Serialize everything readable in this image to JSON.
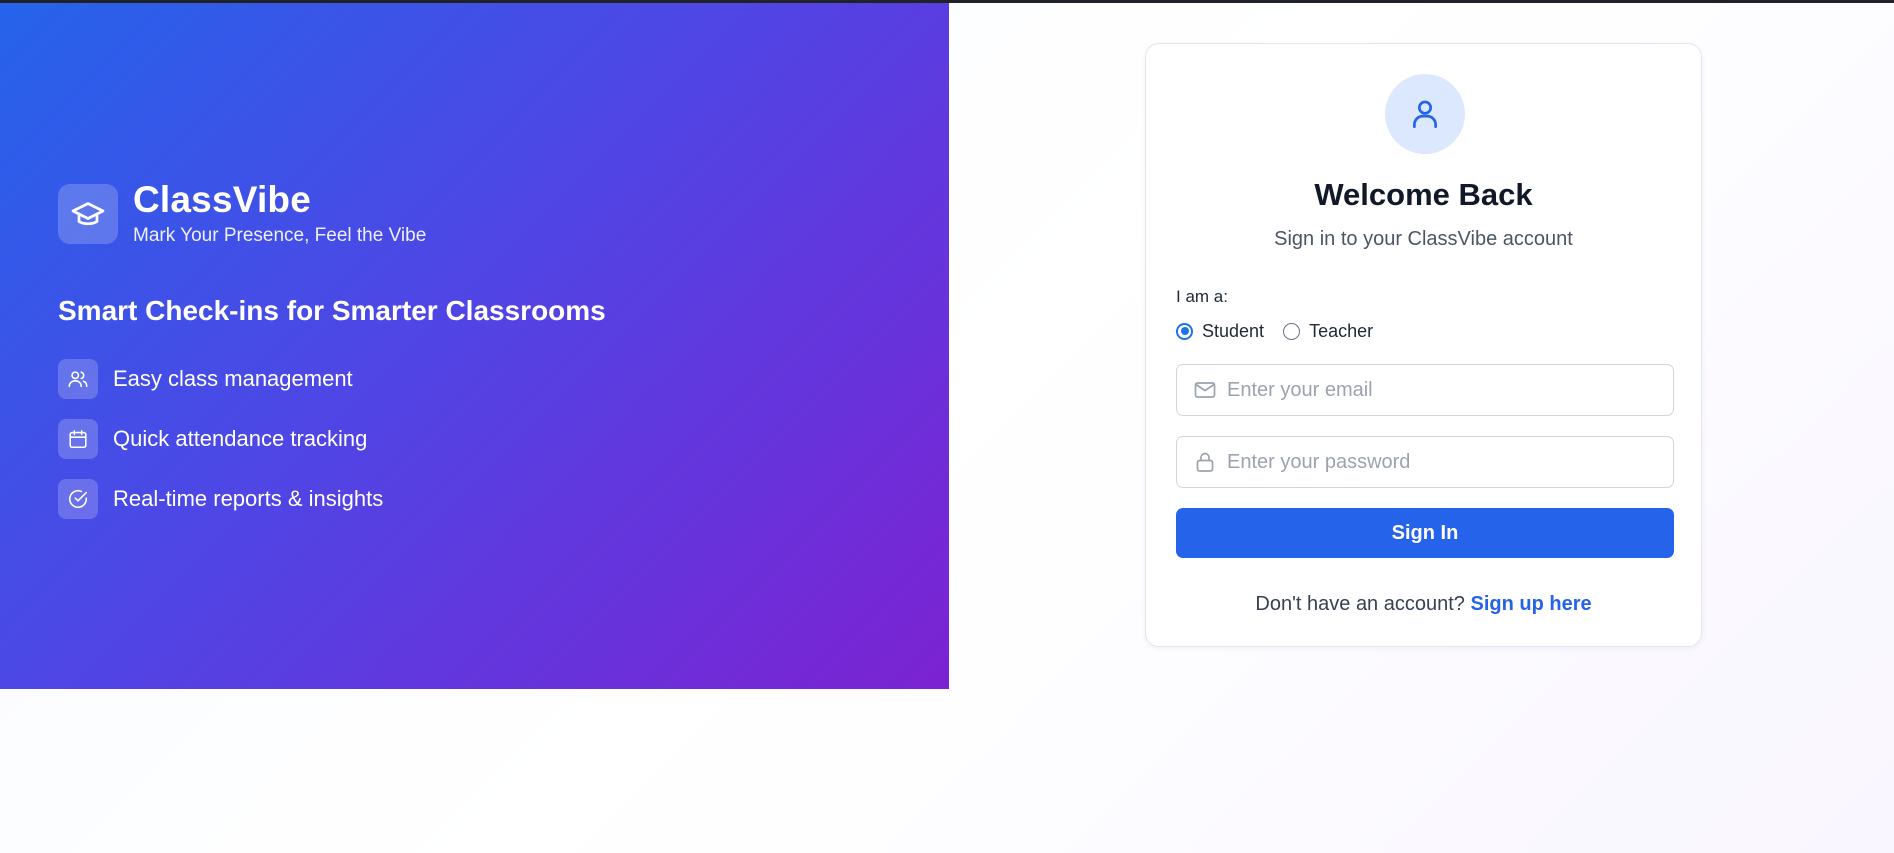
{
  "brand": {
    "name": "ClassVibe",
    "tagline": "Mark Your Presence, Feel the Vibe",
    "logo_icon": "graduation-cap-icon"
  },
  "hero": {
    "headline": "Smart Check-ins for Smarter Classrooms",
    "features": [
      {
        "icon": "users-icon",
        "label": "Easy class management"
      },
      {
        "icon": "calendar-icon",
        "label": "Quick attendance tracking"
      },
      {
        "icon": "check-circle-icon",
        "label": "Real-time reports & insights"
      }
    ],
    "gradient": [
      "#2563eb",
      "#4f46e5",
      "#7c22d2"
    ]
  },
  "login": {
    "avatar_icon": "user-icon",
    "title": "Welcome Back",
    "subtitle": "Sign in to your ClassVibe account",
    "role_label": "I am a:",
    "roles": [
      {
        "label": "Student",
        "selected": true
      },
      {
        "label": "Teacher",
        "selected": false
      }
    ],
    "email": {
      "placeholder": "Enter your email",
      "value": "",
      "icon": "mail-icon"
    },
    "password": {
      "placeholder": "Enter your password",
      "value": "",
      "icon": "lock-icon"
    },
    "submit_label": "Sign In",
    "signup_prompt": "Don't have an account?",
    "signup_link": "Sign up here"
  },
  "colors": {
    "primary": "#2563eb",
    "avatar_bg": "#dbe8fe",
    "text_dark": "#111827"
  }
}
